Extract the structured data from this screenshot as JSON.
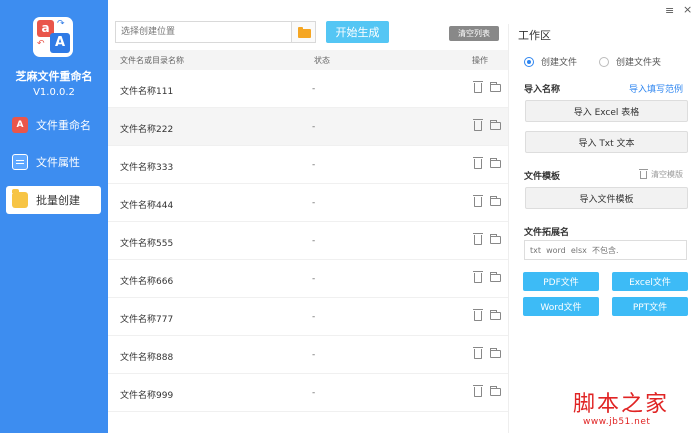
{
  "sidebar": {
    "app_name": "芝麻文件重命名",
    "version": "V1.0.0.2",
    "logo_letters": [
      "a",
      "A"
    ],
    "items": [
      {
        "label": "文件重命名",
        "icon": "rename-icon",
        "active": false
      },
      {
        "label": "文件属性",
        "icon": "document-icon",
        "active": false
      },
      {
        "label": "批量创建",
        "icon": "folder-icon",
        "active": true
      }
    ]
  },
  "toolbar": {
    "location_placeholder": "选择创建位置",
    "start_label": "开始生成",
    "clear_list_label": "清空列表"
  },
  "table": {
    "columns": [
      "文件名或目录名称",
      "状态",
      "操作"
    ],
    "rows": [
      {
        "name": "文件名称111",
        "status": "-"
      },
      {
        "name": "文件名称222",
        "status": "-"
      },
      {
        "name": "文件名称333",
        "status": "-"
      },
      {
        "name": "文件名称444",
        "status": "-"
      },
      {
        "name": "文件名称555",
        "status": "-"
      },
      {
        "name": "文件名称666",
        "status": "-"
      },
      {
        "name": "文件名称777",
        "status": "-"
      },
      {
        "name": "文件名称888",
        "status": "-"
      },
      {
        "name": "文件名称999",
        "status": "-"
      }
    ]
  },
  "window": {
    "menu_icon": "≡",
    "close_icon": "×"
  },
  "panel": {
    "title": "工作区",
    "radio_file": "创建文件",
    "radio_folder": "创建文件夹",
    "import_names_label": "导入名称",
    "import_example_link": "导入填写范例",
    "import_excel": "导入 Excel 表格",
    "import_txt": "导入 Txt 文本",
    "template_label": "文件模板",
    "clear_template": "清空模版",
    "import_template": "导入文件模板",
    "ext_label": "文件拓展名",
    "ext_placeholder": "txt  word  elsx  不包含.",
    "btn_pdf": "PDF文件",
    "btn_excel": "Excel文件",
    "btn_word": "Word文件",
    "btn_ppt": "PPT文件"
  },
  "watermark": {
    "main": "脚本之家",
    "url": "www.jb51.net"
  },
  "colors": {
    "sidebar": "#3d8df0",
    "accent": "#54c6f4",
    "link": "#2f86f0"
  }
}
